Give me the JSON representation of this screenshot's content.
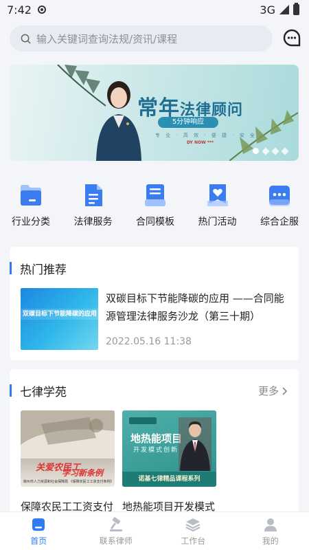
{
  "status": {
    "time": "7:42",
    "network": "3G"
  },
  "search": {
    "placeholder": "输入关键词查询法规/资讯/课程"
  },
  "banner": {
    "title_main": "常年",
    "title_tail": "法律顾问",
    "pill": "5分钟响应",
    "subtitle": "专 业 · 高 效 · 便 捷 · 安 全",
    "logo": "DY NOW ***",
    "slide_count": 4,
    "active_slide": 1
  },
  "quick": [
    {
      "label": "行业分类",
      "icon": "folder-icon"
    },
    {
      "label": "法律服务",
      "icon": "document-icon"
    },
    {
      "label": "合同模板",
      "icon": "contract-icon"
    },
    {
      "label": "热门活动",
      "icon": "heart-bookmark-icon"
    },
    {
      "label": "综合企服",
      "icon": "more-dots-icon"
    }
  ],
  "hot": {
    "title": "热门推荐",
    "item": {
      "thumb_text": "双碳目标下节能降碳的应用",
      "title": "双碳目标下节能降碳的应用 ——合同能源管理法律服务沙龙（第三十期）",
      "date": "2022.05.16 11:38"
    }
  },
  "academy": {
    "title": "七律学苑",
    "more": "更多",
    "courses": [
      {
        "label": "保障农民工工资支付",
        "thumb_t1": "关爱农民工",
        "thumb_t2": "学习新条例",
        "thumb_t3": "柳州市人力资源和社会保障局 《保障农民工工资支付条例》"
      },
      {
        "label": "地热能项目开发模式",
        "thumb_t1": "地热能项目",
        "thumb_t2": "开发模式创新",
        "thumb_t3": "诺基七律精品课程系列"
      }
    ]
  },
  "tabs": [
    {
      "label": "首页",
      "icon": "home-icon",
      "active": true
    },
    {
      "label": "联系律师",
      "icon": "gavel-icon",
      "active": false
    },
    {
      "label": "工作台",
      "icon": "layers-icon",
      "active": false
    },
    {
      "label": "我的",
      "icon": "user-icon",
      "active": false
    }
  ],
  "colors": {
    "accent": "#2f7bf2",
    "icon_blue": "#3b7cf0",
    "icon_light": "#9fc2ff"
  }
}
